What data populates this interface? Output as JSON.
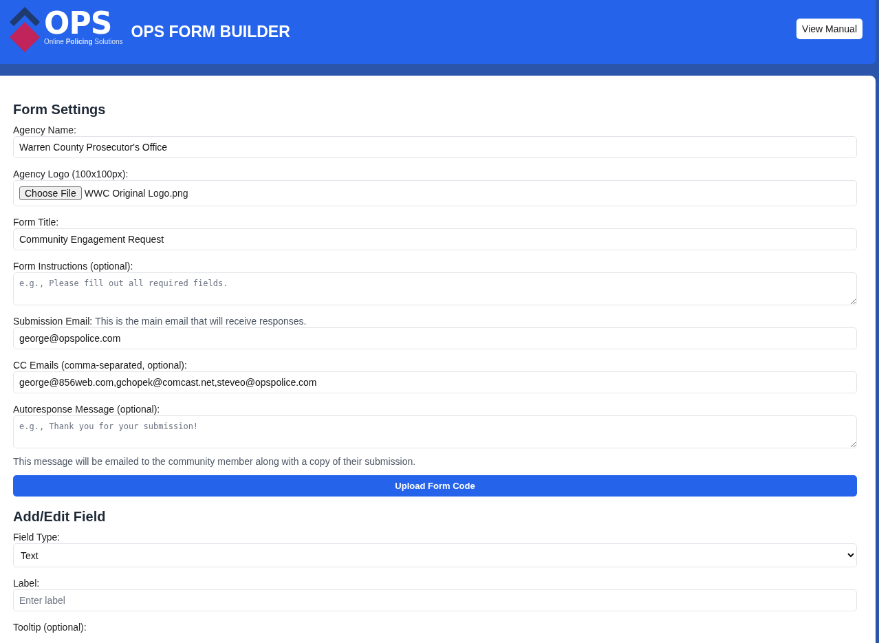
{
  "header": {
    "logo": {
      "wordmark": "OPS",
      "tagline_parts": [
        {
          "text": "Online ",
          "bold": false
        },
        {
          "text": "Policing",
          "bold": true
        },
        {
          "text": " Solutions",
          "bold": false
        }
      ]
    },
    "title": "OPS FORM BUILDER",
    "manual_button": "View Manual"
  },
  "sections": [
    {
      "heading": "Form Settings",
      "items": [
        {
          "kind": "text",
          "label": "Agency Name:",
          "value": "Warren County Prosecutor's Office"
        },
        {
          "kind": "file",
          "label": "Agency Logo (100x100px):",
          "button": "Choose File",
          "value": "WWC Original Logo.png"
        },
        {
          "kind": "text",
          "label": "Form Title:",
          "value": "Community Engagement Request"
        },
        {
          "kind": "textarea",
          "label": "Form Instructions (optional):",
          "placeholder": "e.g., Please fill out all required fields."
        },
        {
          "kind": "text",
          "label": "Submission Email:",
          "hint": "This is the main email that will receive responses.",
          "value": "george@opspolice.com"
        },
        {
          "kind": "text",
          "label": "CC Emails (comma-separated, optional):",
          "value": "george@856web.com,gchopek@comcast.net,steveo@opspolice.com"
        },
        {
          "kind": "textarea",
          "label": "Autoresponse Message (optional):",
          "placeholder": "e.g., Thank you for your submission!"
        },
        {
          "kind": "note",
          "text": "This message will be emailed to the community member along with a copy of their submission."
        },
        {
          "kind": "button",
          "text": "Upload Form Code"
        }
      ]
    },
    {
      "heading": "Add/Edit Field",
      "items": [
        {
          "kind": "select",
          "label": "Field Type:",
          "value": "Text"
        },
        {
          "kind": "text",
          "label": "Label:",
          "placeholder": "Enter label"
        },
        {
          "kind": "label",
          "label": "Tooltip (optional):"
        }
      ]
    }
  ]
}
